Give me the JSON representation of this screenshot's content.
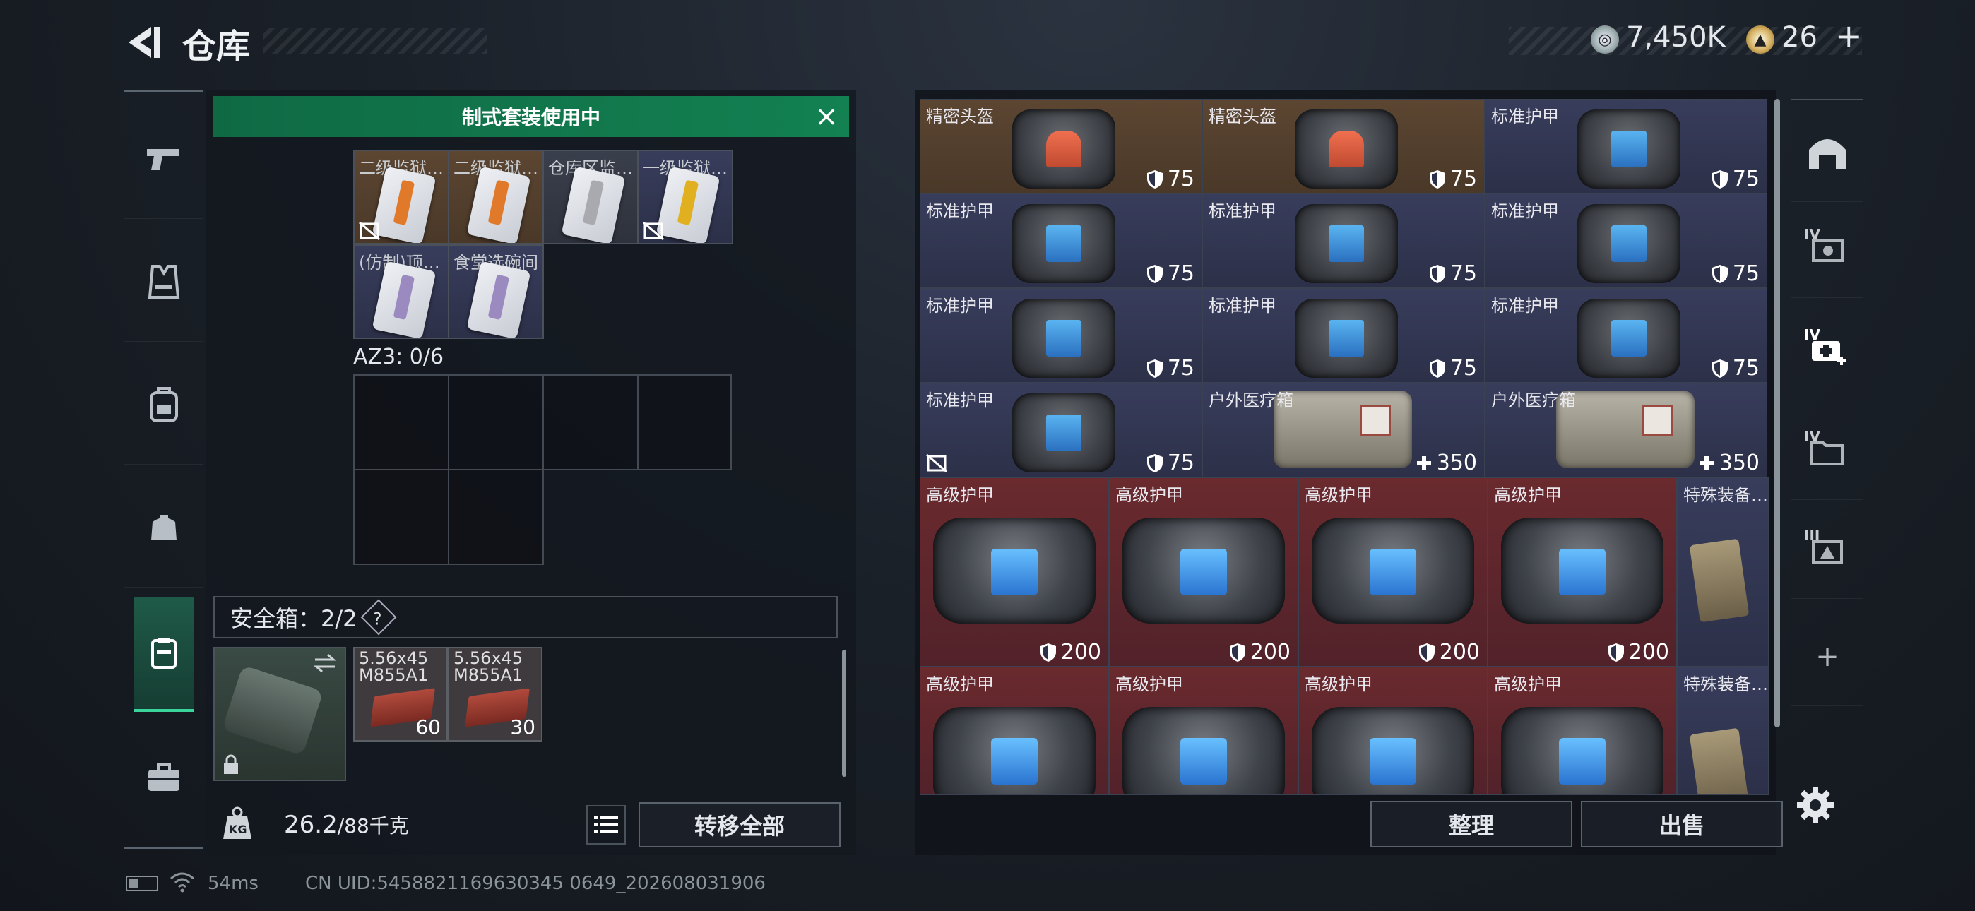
{
  "header": {
    "title": "仓库"
  },
  "currency": {
    "silver": "7,450K",
    "gold": "26"
  },
  "colors": {
    "accent_green": "#138152",
    "active_tab": "#3bd49a",
    "orange_rarity": "#5c4632",
    "purple_rarity": "#383d5c",
    "red_rarity": "#6a2a2e"
  },
  "left_rail": [
    {
      "icon": "pistol-icon"
    },
    {
      "icon": "vest-icon"
    },
    {
      "icon": "backpack-icon"
    },
    {
      "icon": "pouch-icon"
    },
    {
      "icon": "container-icon",
      "active": true
    },
    {
      "icon": "briefcase-icon"
    }
  ],
  "loadout": {
    "banner": "制式套装使用中",
    "cards": [
      {
        "name": "二级监狱…",
        "stripe": "#e07a2a",
        "disabled": true
      },
      {
        "name": "二级监狱…",
        "stripe": "#e07a2a",
        "disabled": false
      },
      {
        "name": "仓库区监…",
        "stripe": "#a8aab0",
        "disabled": false
      },
      {
        "name": "一级监狱…",
        "stripe": "#e0b020",
        "disabled": true
      },
      {
        "name": "(仿制)顶…",
        "stripe": "#9a8ac0",
        "disabled": false
      },
      {
        "name": "食堂选碗间",
        "stripe": "#9a8ac0",
        "disabled": false
      }
    ],
    "az3_label": "AZ3: 0/6",
    "safebox_label": "安全箱：2/2",
    "safebox_help": "?",
    "ammo": [
      {
        "name": "5.56x45 M855A1",
        "count": "60"
      },
      {
        "name": "5.56x45 M855A1",
        "count": "30"
      }
    ],
    "weight_value": "26.2",
    "weight_unit": "/88千克",
    "move_all": "转移全部"
  },
  "stash": {
    "rows": [
      [
        {
          "name": "精密头盔",
          "stat": "75",
          "type": "helmet",
          "rarity": "orange"
        },
        {
          "name": "精密头盔",
          "stat": "75",
          "type": "helmet",
          "rarity": "orange"
        },
        {
          "name": "标准护甲",
          "stat": "75",
          "type": "armor",
          "rarity": "purple"
        }
      ],
      [
        {
          "name": "标准护甲",
          "stat": "75",
          "type": "armor",
          "rarity": "purple"
        },
        {
          "name": "标准护甲",
          "stat": "75",
          "type": "armor",
          "rarity": "purple"
        },
        {
          "name": "标准护甲",
          "stat": "75",
          "type": "armor",
          "rarity": "purple"
        }
      ],
      [
        {
          "name": "标准护甲",
          "stat": "75",
          "type": "armor",
          "rarity": "purple"
        },
        {
          "name": "标准护甲",
          "stat": "75",
          "type": "armor",
          "rarity": "purple"
        },
        {
          "name": "标准护甲",
          "stat": "75",
          "type": "armor",
          "rarity": "purple"
        }
      ],
      [
        {
          "name": "标准护甲",
          "stat": "75",
          "type": "armor",
          "rarity": "purple",
          "disabled": true
        },
        {
          "name": "户外医疗箱",
          "stat": "350",
          "type": "medkit",
          "rarity": "purple"
        },
        {
          "name": "户外医疗箱",
          "stat": "350",
          "type": "medkit",
          "rarity": "purple"
        }
      ]
    ],
    "big_rows": [
      [
        {
          "name": "高级护甲",
          "stat": "200"
        },
        {
          "name": "高级护甲",
          "stat": "200"
        },
        {
          "name": "高级护甲",
          "stat": "200"
        },
        {
          "name": "高级护甲",
          "stat": "200"
        },
        {
          "name": "特殊装备…",
          "stat": ""
        }
      ],
      [
        {
          "name": "高级护甲",
          "stat": ""
        },
        {
          "name": "高级护甲",
          "stat": ""
        },
        {
          "name": "高级护甲",
          "stat": ""
        },
        {
          "name": "高级护甲",
          "stat": ""
        },
        {
          "name": "特殊装备…",
          "stat": ""
        }
      ]
    ],
    "sort": "整理",
    "sell": "出售"
  },
  "right_sidebar": [
    {
      "icon": "bunker-icon",
      "tier": ""
    },
    {
      "icon": "gear-box-icon",
      "tier": "IV"
    },
    {
      "icon": "medical-add-icon",
      "tier": "IV"
    },
    {
      "icon": "folder-icon",
      "tier": "IV"
    },
    {
      "icon": "map-icon",
      "tier": "III"
    },
    {
      "icon": "add-icon",
      "tier": ""
    }
  ],
  "status": {
    "ping": "54ms",
    "uid": "CN UID:5458821169630345 0649_202608031906"
  }
}
